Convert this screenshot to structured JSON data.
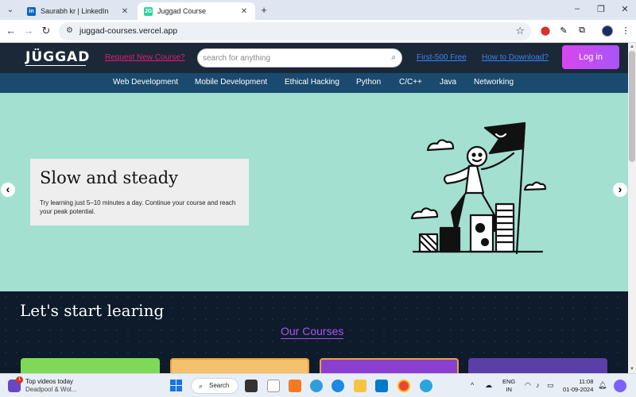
{
  "browser": {
    "tabs": [
      {
        "title": "Saurabh kr | LinkedIn",
        "favicon": "in",
        "active": false
      },
      {
        "title": "Juggad Course",
        "favicon": "JG",
        "active": true
      }
    ],
    "url": "juggad-courses.vercel.app",
    "icons": [
      "tab-search-icon",
      "close-icon",
      "new-tab-icon",
      "minimize-icon",
      "restore-icon",
      "back-icon",
      "forward-icon",
      "reload-icon",
      "site-info-icon",
      "star-icon",
      "extension-icon",
      "profile-avatar"
    ]
  },
  "header": {
    "logo": "JÜGGAD",
    "request_link": "Request New Course?",
    "search_placeholder": "search for anything",
    "first_free": "First-500 Free",
    "how_download": "How to Download?",
    "login": "Log in",
    "accent": "#a855f7"
  },
  "categories": [
    "Web Development",
    "Mobile Development",
    "Ethical Hacking",
    "Python",
    "C/C++",
    "Java",
    "Networking"
  ],
  "hero": {
    "title": "Slow and steady",
    "subtitle": "Try learning just 5–10 minutes a day. Continue your course and reach your peak potential.",
    "background": "#a3e0d0"
  },
  "courses": {
    "heading": "Let's start learing",
    "subheading": "Our Courses",
    "card_colors": [
      "#7ed957",
      "#f5c16c",
      "#e8a33d",
      "#5b3fa8"
    ]
  },
  "taskbar": {
    "news_title": "Top videos today",
    "news_sub": "Deadpool & Wol...",
    "news_badge": "1",
    "search_label": "Search",
    "lang_top": "ENG",
    "lang_bottom": "IN",
    "time": "11:08",
    "date": "01-09-2024"
  }
}
